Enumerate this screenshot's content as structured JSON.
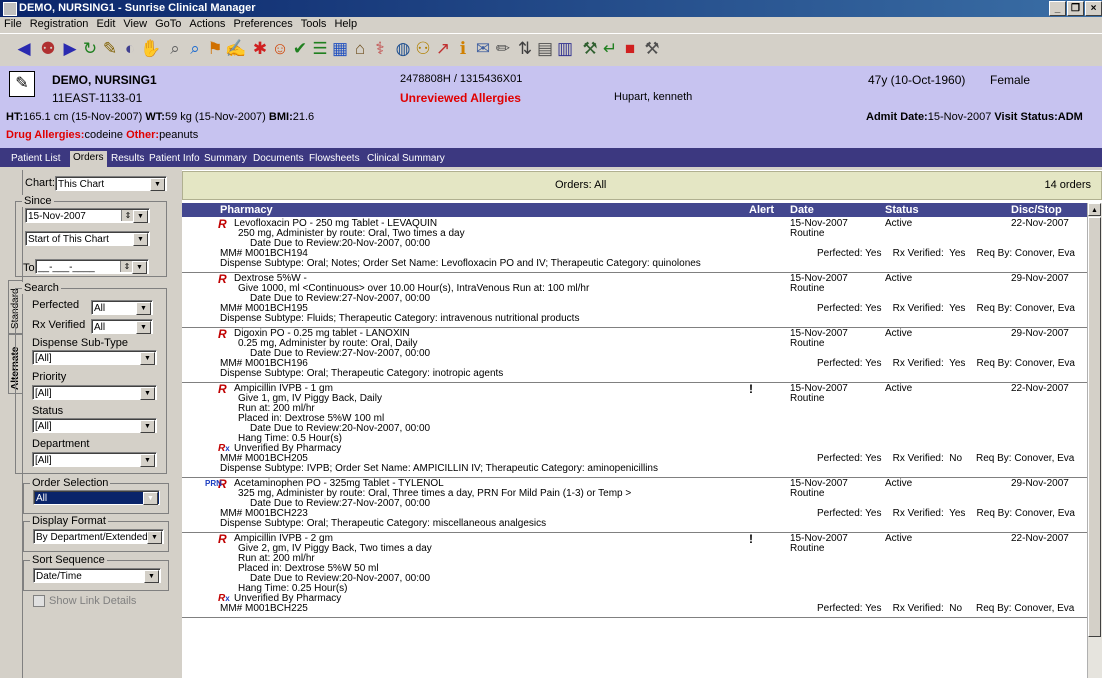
{
  "window": {
    "title": "DEMO, NURSING1 - Sunrise Clinical Manager",
    "controls": [
      "_",
      "❒",
      "×"
    ]
  },
  "menu": [
    "File",
    "Registration",
    "Edit",
    "View",
    "GoTo",
    "Actions",
    "Preferences",
    "Tools",
    "Help"
  ],
  "toolbar_icons": [
    {
      "name": "back-icon",
      "glyph": "◀",
      "color": "#2a2ab0"
    },
    {
      "name": "people-icon",
      "glyph": "⚉",
      "color": "#b03030"
    },
    {
      "name": "forward-icon",
      "glyph": "▶",
      "color": "#2a2ab0"
    },
    {
      "name": "refresh-icon",
      "glyph": "↻",
      "color": "#208020"
    },
    {
      "name": "edit-icon",
      "glyph": "✎",
      "color": "#806000"
    },
    {
      "name": "view-icon",
      "glyph": "◐",
      "color": "#404090"
    },
    {
      "name": "hand-icon",
      "glyph": "✋",
      "color": "#808080"
    },
    {
      "name": "search-icon",
      "glyph": "⌕",
      "color": "#606060"
    },
    {
      "name": "search-list-icon",
      "glyph": "⌕",
      "color": "#1a6ad0"
    },
    {
      "name": "flag-icon",
      "glyph": "⚑",
      "color": "#d07000"
    },
    {
      "name": "pen-icon",
      "glyph": "✍",
      "color": "#404040"
    },
    {
      "name": "star-person-icon",
      "glyph": "✱",
      "color": "#d02020"
    },
    {
      "name": "person-icon",
      "glyph": "☺",
      "color": "#d04000"
    },
    {
      "name": "check-icon",
      "glyph": "✔",
      "color": "#208020"
    },
    {
      "name": "chart-icon",
      "glyph": "☰",
      "color": "#208020"
    },
    {
      "name": "grid-icon",
      "glyph": "▦",
      "color": "#2050c0"
    },
    {
      "name": "building-icon",
      "glyph": "⌂",
      "color": "#705020"
    },
    {
      "name": "pill-icon",
      "glyph": "⚕",
      "color": "#c04040"
    },
    {
      "name": "globe-icon",
      "glyph": "◍",
      "color": "#205090"
    },
    {
      "name": "network-icon",
      "glyph": "⚇",
      "color": "#b08000"
    },
    {
      "name": "syringe-icon",
      "glyph": "↗",
      "color": "#c03030"
    },
    {
      "name": "info-icon",
      "glyph": "ℹ",
      "color": "#d08000"
    },
    {
      "name": "message-icon",
      "glyph": "✉",
      "color": "#4060a0"
    },
    {
      "name": "signature-icon",
      "glyph": "✏",
      "color": "#505050"
    },
    {
      "name": "sort-icon",
      "glyph": "⇅",
      "color": "#404040"
    },
    {
      "name": "table-icon",
      "glyph": "▤",
      "color": "#505050"
    },
    {
      "name": "columns-icon",
      "glyph": "▥",
      "color": "#303090"
    },
    {
      "name": "tools-icon",
      "glyph": "⚒",
      "color": "#306030"
    },
    {
      "name": "exit-icon",
      "glyph": "↵",
      "color": "#208020"
    },
    {
      "name": "bookmark-icon",
      "glyph": "■",
      "color": "#d02020"
    },
    {
      "name": "wrench-icon",
      "glyph": "⚒",
      "color": "#505050"
    }
  ],
  "patient": {
    "name": "DEMO, NURSING1",
    "location": "11EAST-1133-01",
    "mrn": "2478808H / 1315436X01",
    "unreviewed": "Unreviewed Allergies",
    "physician": "Hupart, kenneth",
    "age": "47y (10-Oct-1960)",
    "sex": "Female",
    "ht_label": "HT:",
    "ht": "165.1 cm (15-Nov-2007)",
    "wt_label": "WT:",
    "wt": "59 kg (15-Nov-2007)",
    "bmi_label": "BMI:",
    "bmi": "21.6",
    "admit_label": "Admit Date:",
    "admit": "15-Nov-2007",
    "visit_label": "Visit Status:",
    "visit": "ADM",
    "drug_allergy_label": "Drug Allergies:",
    "drug_allergy": "codeine",
    "other_label": "Other:",
    "other": "peanuts"
  },
  "tabs": [
    "Patient List",
    "Orders",
    "Results",
    "Patient Info",
    "Summary",
    "Documents",
    "Flowsheets",
    "Clinical Summary"
  ],
  "side_tabs": {
    "standard": "Standard",
    "alternate": "Alternate"
  },
  "filters": {
    "chart_label": "Chart:",
    "chart_value": "This Chart",
    "since_label": "Since",
    "since_date": "15-Nov-2007",
    "since_from": "Start of This Chart",
    "to_label": "To:",
    "to_value": "__-___-____",
    "search_label": "Search",
    "perfected_label": "Perfected",
    "perfected_value": "All",
    "rxverified_label": "Rx Verified",
    "rxverified_value": "All",
    "dispense_label": "Dispense Sub-Type",
    "dispense_value": "[All]",
    "priority_label": "Priority",
    "priority_value": "[All]",
    "status_label": "Status",
    "status_value": "[All]",
    "department_label": "Department",
    "department_value": "[All]",
    "order_sel_label": "Order Selection",
    "order_sel_value": "All",
    "display_label": "Display Format",
    "display_value": "By Department/Extended",
    "sort_label": "Sort Sequence",
    "sort_value": "Date/Time",
    "show_link": "Show Link Details"
  },
  "orders_bar": {
    "title": "Orders: All",
    "count": "14 orders"
  },
  "grid": {
    "section": "Pharmacy",
    "alert": "Alert",
    "date": "Date",
    "status": "Status",
    "disc": "Disc/Stop"
  },
  "orders": [
    {
      "lines": [
        "Levofloxacin PO - 250 mg Tablet - LEVAQUIN",
        "250 mg, Administer by route: Oral, Two times a day",
        "Date Due to Review:20-Nov-2007, 00:00"
      ],
      "date": "15-Nov-2007",
      "routine": "Routine",
      "status": "Active",
      "disc": "22-Nov-2007",
      "alert": "",
      "prn": "",
      "unverified": "",
      "mm": "MM#  M001BCH194",
      "meta": "Perfected: Yes    Rx Verified:  Yes    Req By: Conover, Eva",
      "dispense": "Dispense Subtype: Oral;  Notes;  Order Set Name: Levofloxacin  PO and IV;  Therapeutic Category: quinolones"
    },
    {
      "lines": [
        "Dextrose 5%W -",
        "Give 1000, ml <Continuous> over 10.00 Hour(s), IntraVenous Run at: 100 ml/hr",
        "Date Due to Review:27-Nov-2007, 00:00"
      ],
      "date": "15-Nov-2007",
      "routine": "Routine",
      "status": "Active",
      "disc": "29-Nov-2007",
      "alert": "",
      "prn": "",
      "unverified": "",
      "mm": "MM#  M001BCH195",
      "meta": "Perfected: Yes    Rx Verified:  Yes    Req By: Conover, Eva",
      "dispense": "Dispense Subtype: Fluids;  Therapeutic Category: intravenous nutritional products"
    },
    {
      "lines": [
        "Digoxin PO - 0.25 mg tablet - LANOXIN",
        "0.25 mg, Administer by route: Oral, Daily",
        "Date Due to Review:27-Nov-2007, 00:00"
      ],
      "date": "15-Nov-2007",
      "routine": "Routine",
      "status": "Active",
      "disc": "29-Nov-2007",
      "alert": "",
      "prn": "",
      "unverified": "",
      "mm": "MM#  M001BCH196",
      "meta": "Perfected: Yes    Rx Verified:  Yes    Req By: Conover, Eva",
      "dispense": "Dispense Subtype: Oral;  Therapeutic Category: inotropic agents"
    },
    {
      "lines": [
        "Ampicillin IVPB - 1 gm",
        "Give 1, gm, IV Piggy Back, Daily",
        "Run at: 200 ml/hr",
        "Placed in: Dextrose 5%W 100 ml",
        "Date Due to Review:20-Nov-2007, 00:00",
        "Hang Time: 0.5 Hour(s)"
      ],
      "date": "15-Nov-2007",
      "routine": "Routine",
      "status": "Active",
      "disc": "22-Nov-2007",
      "alert": "!",
      "prn": "",
      "unverified": "Unverified By Pharmacy",
      "mm": "MM#  M001BCH205",
      "meta": "Perfected: Yes    Rx Verified:  No     Req By: Conover, Eva",
      "dispense": "Dispense Subtype: IVPB;  Order Set Name: AMPICILLIN   IV;  Therapeutic Category: aminopenicillins"
    },
    {
      "lines": [
        "Acetaminophen PO - 325mg Tablet - TYLENOL",
        "325 mg, Administer by route: Oral, Three times a day, PRN For Mild Pain (1-3) or Temp >",
        "Date Due to Review:27-Nov-2007, 00:00"
      ],
      "date": "15-Nov-2007",
      "routine": "Routine",
      "status": "Active",
      "disc": "29-Nov-2007",
      "alert": "",
      "prn": "PRN",
      "unverified": "",
      "mm": "MM#  M001BCH223",
      "meta": "Perfected: Yes    Rx Verified:  Yes    Req By: Conover, Eva",
      "dispense": "Dispense Subtype: Oral;  Therapeutic Category: miscellaneous analgesics"
    },
    {
      "lines": [
        "Ampicillin IVPB - 2 gm",
        "Give 2, gm, IV Piggy Back, Two times a day",
        "Run at: 200 ml/hr",
        "Placed in: Dextrose 5%W 50 ml",
        "Date Due to Review:20-Nov-2007, 00:00",
        "Hang Time: 0.25 Hour(s)"
      ],
      "date": "15-Nov-2007",
      "routine": "Routine",
      "status": "Active",
      "disc": "22-Nov-2007",
      "alert": "!",
      "prn": "",
      "unverified": "Unverified By Pharmacy",
      "mm": "MM#  M001BCH225",
      "meta": "Perfected: Yes    Rx Verified:  No     Req By: Conover, Eva",
      "dispense": ""
    }
  ]
}
